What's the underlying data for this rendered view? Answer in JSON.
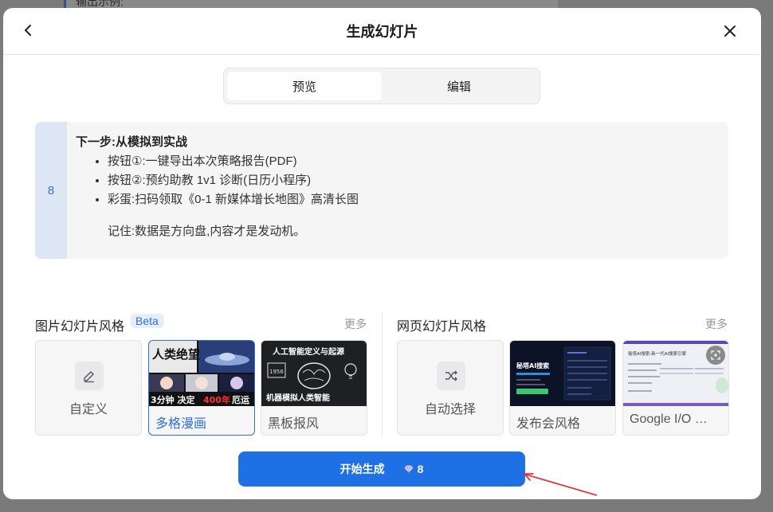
{
  "background": {
    "peek_text": "输出示例:"
  },
  "dialog": {
    "title": "生成幻灯片",
    "back_icon": "chevron-left-icon",
    "close_icon": "close-icon"
  },
  "tabs": [
    {
      "label": "预览",
      "active": true
    },
    {
      "label": "编辑",
      "active": false
    }
  ],
  "slide": {
    "number": "8",
    "heading": "下一步:从模拟到实战",
    "bullets": [
      "按钮①:一键导出本次策略报告(PDF)",
      "按钮②:预约助教 1v1 诊断(日历小程序)",
      "彩蛋:扫码领取《0-1 新媒体增长地图》高清长图"
    ],
    "note": "记住:数据是方向盘,内容才是发动机。"
  },
  "image_styles": {
    "label": "图片幻灯片风格",
    "badge": "Beta",
    "more": "更多",
    "cards": [
      {
        "label": "自定义",
        "icon": "pencil-icon",
        "selected": false
      },
      {
        "label": "多格漫画",
        "selected": true,
        "thumb_text": {
          "top": "人类绝望",
          "bottom_a": "3分钟 决定",
          "bottom_b": "400年",
          "bottom_c": "厄运"
        }
      },
      {
        "label": "黑板报风",
        "selected": false,
        "thumb_text": {
          "top": "人工智能定义与起源",
          "bottom": "机器模拟人类智能",
          "year": "1956"
        }
      }
    ]
  },
  "web_styles": {
    "label": "网页幻灯片风格",
    "more": "更多",
    "cards": [
      {
        "label": "自动选择",
        "icon": "shuffle-icon",
        "selected": false
      },
      {
        "label": "发布会风格",
        "selected": false,
        "thumb_text": {
          "title": "秘塔AI搜索"
        }
      },
      {
        "label": "Google I/O …",
        "selected": false,
        "thumb_text": {
          "title": "秘塔AI搜索:新一代AI搜索引擎"
        }
      }
    ]
  },
  "start_button": {
    "label": "开始生成",
    "cost": "8",
    "cost_icon": "diamond-icon"
  },
  "colors": {
    "primary": "#1f6fe5",
    "accent_text": "#2f6fd6",
    "slide_number_bg": "#dce6f5",
    "arrow": "#e03a3a"
  }
}
